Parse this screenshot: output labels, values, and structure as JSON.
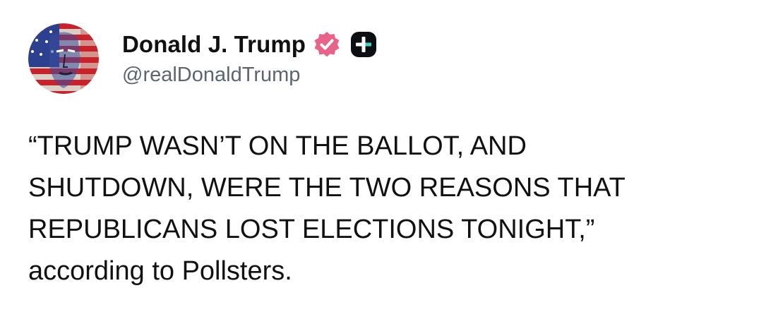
{
  "author": {
    "display_name": "Donald J. Trump",
    "handle": "@realDonaldTrump",
    "avatar_icon": "flag-portrait-avatar",
    "verified_icon": "verified-badge-icon",
    "verified_color": "#e8638a",
    "extra_badge_icon": "plus-badge-icon",
    "extra_badge_color": "#0b0f14",
    "extra_badge_accent": "#3fd1c1"
  },
  "post": {
    "lines": [
      "“TRUMP WASN’T ON THE BALLOT, AND",
      "SHUTDOWN, WERE THE TWO REASONS THAT",
      "REPUBLICANS LOST ELECTIONS TONIGHT,”",
      "according to Pollsters."
    ]
  }
}
